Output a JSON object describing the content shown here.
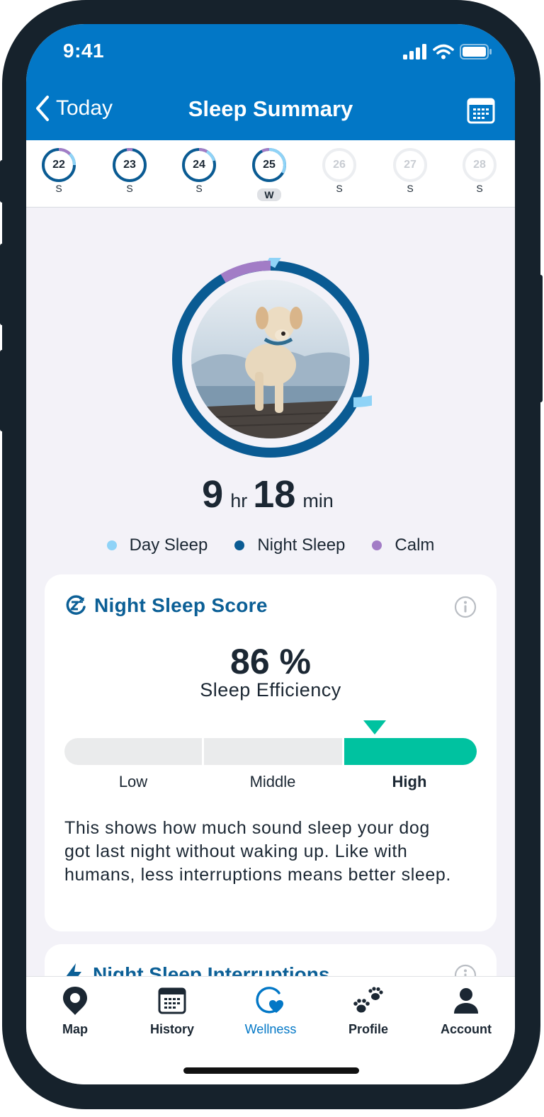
{
  "status_bar": {
    "time": "9:41"
  },
  "nav": {
    "back_label": "Today",
    "title": "Sleep Summary"
  },
  "days": [
    {
      "num": "22",
      "letter": "S",
      "state": "past"
    },
    {
      "num": "23",
      "letter": "S",
      "state": "past"
    },
    {
      "num": "24",
      "letter": "S",
      "state": "past"
    },
    {
      "num": "25",
      "letter": "W",
      "state": "selected"
    },
    {
      "num": "26",
      "letter": "S",
      "state": "future"
    },
    {
      "num": "27",
      "letter": "S",
      "state": "future"
    },
    {
      "num": "28",
      "letter": "S",
      "state": "future"
    }
  ],
  "summary": {
    "hours": "9",
    "hours_unit": "hr",
    "minutes": "18",
    "minutes_unit": "min"
  },
  "legend": [
    {
      "label": "Day Sleep",
      "color": "#8fd3f7"
    },
    {
      "label": "Night Sleep",
      "color": "#0a5b93"
    },
    {
      "label": "Calm",
      "color": "#a27cc6"
    }
  ],
  "score_card": {
    "title": "Night Sleep Score",
    "value": "86 %",
    "label": "Sleep Efficiency",
    "scale": {
      "low": "Low",
      "middle": "Middle",
      "high": "High"
    },
    "active_level": "High",
    "description": "This shows how much sound sleep your dog got last night without waking up. Like with humans, less interruptions means better sleep."
  },
  "interruptions_card": {
    "title": "Night Sleep Interruptions"
  },
  "tabs": [
    {
      "label": "Map",
      "icon": "map-pin-icon"
    },
    {
      "label": "History",
      "icon": "calendar-icon"
    },
    {
      "label": "Wellness",
      "icon": "wellness-heart-icon",
      "active": true
    },
    {
      "label": "Profile",
      "icon": "paw-icon"
    },
    {
      "label": "Account",
      "icon": "person-icon"
    }
  ],
  "colors": {
    "brand_blue": "#0277c6",
    "score_title": "#0b5f96",
    "high_green": "#00c2a0",
    "ring_day": "#8fd3f7",
    "ring_night": "#0a5b93",
    "ring_calm": "#a27cc6"
  }
}
